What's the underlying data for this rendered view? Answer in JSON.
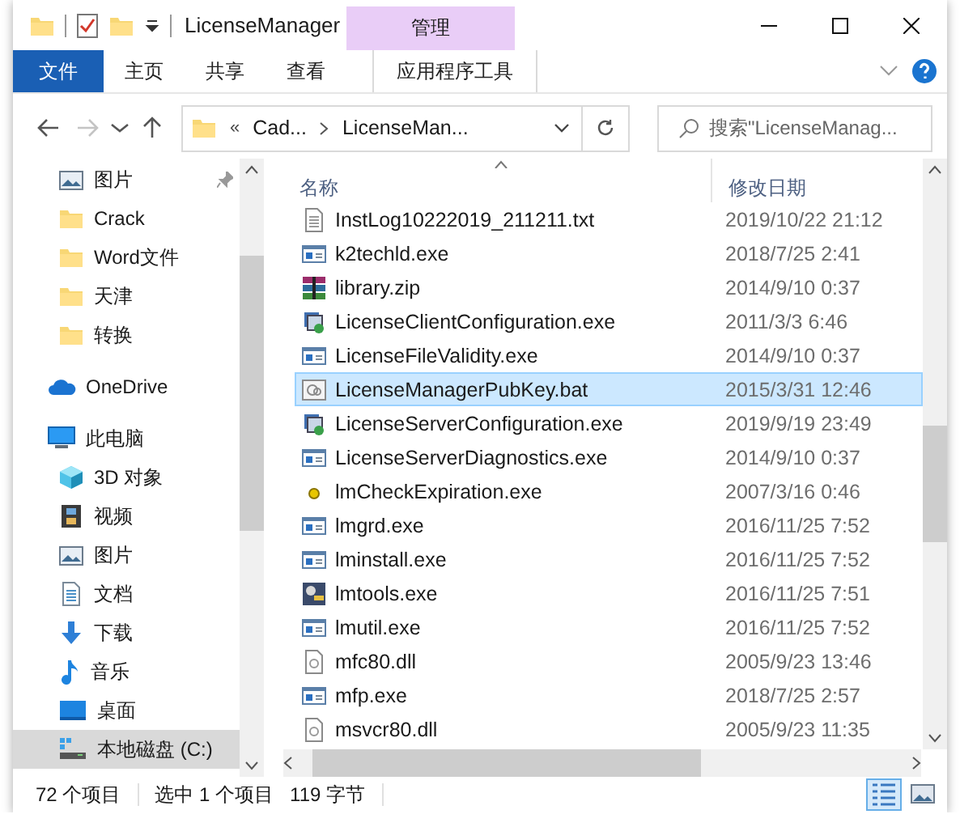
{
  "window": {
    "title": "LicenseManager",
    "context_group": "管理"
  },
  "ribbon_tabs": [
    {
      "label": "文件",
      "kind": "file"
    },
    {
      "label": "主页",
      "kind": "tab"
    },
    {
      "label": "共享",
      "kind": "tab"
    },
    {
      "label": "查看",
      "kind": "tab"
    },
    {
      "label": "应用程序工具",
      "kind": "contextual"
    }
  ],
  "navigation": [
    {
      "kind": "back",
      "disabled": false
    },
    {
      "kind": "forward",
      "disabled": true
    },
    {
      "kind": "recent",
      "disabled": false
    },
    {
      "kind": "up",
      "disabled": false
    }
  ],
  "address": {
    "overflow": "«",
    "segments": [
      "Cad...",
      "LicenseMan..."
    ]
  },
  "search": {
    "placeholder": "搜索\"LicenseManag..."
  },
  "sidebar": {
    "quick_access": [
      {
        "label": "图片",
        "kind": "picture",
        "pinned": true
      },
      {
        "label": "Crack",
        "kind": "folder",
        "pinned": false
      },
      {
        "label": "Word文件",
        "kind": "folder",
        "pinned": false
      },
      {
        "label": "天津",
        "kind": "folder",
        "pinned": false
      },
      {
        "label": "转换",
        "kind": "folder",
        "pinned": false
      }
    ],
    "items": [
      {
        "label": "OneDrive",
        "kind": "onedrive",
        "selected": false
      },
      {
        "label": "此电脑",
        "kind": "pc",
        "selected": false,
        "children": [
          {
            "label": "3D 对象",
            "kind": "cube",
            "selected": false
          },
          {
            "label": "视频",
            "kind": "video",
            "selected": false
          },
          {
            "label": "图片",
            "kind": "picture",
            "selected": false
          },
          {
            "label": "文档",
            "kind": "doc",
            "selected": false
          },
          {
            "label": "下载",
            "kind": "download",
            "selected": false
          },
          {
            "label": "音乐",
            "kind": "music",
            "selected": false
          },
          {
            "label": "桌面",
            "kind": "desktop",
            "selected": false
          },
          {
            "label": "本地磁盘 (C:)",
            "kind": "drive",
            "selected": true
          }
        ]
      }
    ]
  },
  "table": {
    "columns": [
      {
        "label": "名称",
        "sorted": true
      },
      {
        "label": "修改日期",
        "sorted": false
      }
    ],
    "rows": [
      {
        "name": "InstLog10222019_211211.txt",
        "date": "2019/10/22 21:12",
        "kind": "text",
        "selected": false
      },
      {
        "name": "k2techld.exe",
        "date": "2018/7/25 2:41",
        "kind": "exe",
        "selected": false
      },
      {
        "name": "library.zip",
        "date": "2014/9/10 0:37",
        "kind": "archive",
        "selected": false
      },
      {
        "name": "LicenseClientConfiguration.exe",
        "date": "2011/3/3 6:46",
        "kind": "setup",
        "selected": false
      },
      {
        "name": "LicenseFileValidity.exe",
        "date": "2014/9/10 0:37",
        "kind": "exe",
        "selected": false
      },
      {
        "name": "LicenseManagerPubKey.bat",
        "date": "2015/3/31 12:46",
        "kind": "batch",
        "selected": true
      },
      {
        "name": "LicenseServerConfiguration.exe",
        "date": "2019/9/19 23:49",
        "kind": "setup",
        "selected": false
      },
      {
        "name": "LicenseServerDiagnostics.exe",
        "date": "2014/9/10 0:37",
        "kind": "exe",
        "selected": false
      },
      {
        "name": "lmCheckExpiration.exe",
        "date": "2007/3/16 0:46",
        "kind": "dot",
        "selected": false
      },
      {
        "name": "lmgrd.exe",
        "date": "2016/11/25 7:52",
        "kind": "exe",
        "selected": false
      },
      {
        "name": "lminstall.exe",
        "date": "2016/11/25 7:52",
        "kind": "exe",
        "selected": false
      },
      {
        "name": "lmtools.exe",
        "date": "2016/11/25 7:51",
        "kind": "tools",
        "selected": false
      },
      {
        "name": "lmutil.exe",
        "date": "2016/11/25 7:52",
        "kind": "exe",
        "selected": false
      },
      {
        "name": "mfc80.dll",
        "date": "2005/9/23 13:46",
        "kind": "dll",
        "selected": false
      },
      {
        "name": "mfp.exe",
        "date": "2018/7/25 2:57",
        "kind": "exe",
        "selected": false
      },
      {
        "name": "msvcr80.dll",
        "date": "2005/9/23 11:35",
        "kind": "dll",
        "selected": false
      }
    ]
  },
  "status_bar": {
    "item_count": "72 个项目",
    "selection": "选中 1 个项目",
    "size": "119 字节"
  },
  "view_buttons": [
    {
      "kind": "details",
      "selected": true
    },
    {
      "kind": "large_icons",
      "selected": false
    }
  ]
}
